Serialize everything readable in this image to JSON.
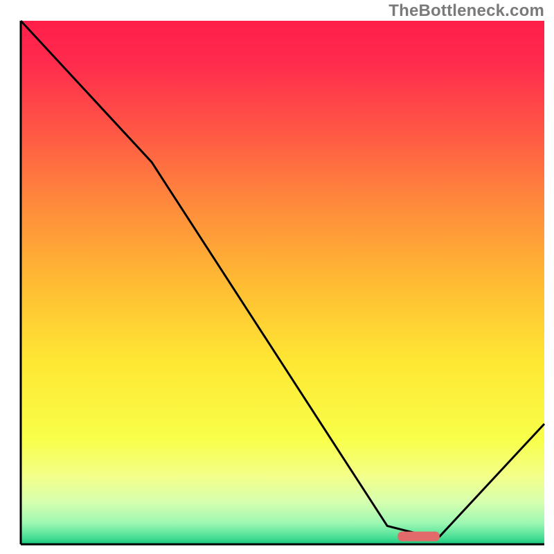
{
  "watermark": "TheBottleneck.com",
  "chart_data": {
    "type": "line",
    "title": "",
    "xlabel": "",
    "ylabel": "",
    "xlim": [
      0,
      100
    ],
    "ylim": [
      0,
      100
    ],
    "series": [
      {
        "name": "bottleneck-curve",
        "x": [
          0,
          25,
          70,
          78,
          80,
          100
        ],
        "values": [
          100,
          73,
          3.5,
          1.5,
          1.5,
          23
        ]
      }
    ],
    "marker": {
      "x_start": 72,
      "x_end": 80,
      "y": 1.5,
      "color": "#e36a6a"
    },
    "gradient_stops": [
      {
        "offset": 0.0,
        "color": "#ff1f4a"
      },
      {
        "offset": 0.08,
        "color": "#ff2b4d"
      },
      {
        "offset": 0.2,
        "color": "#ff5346"
      },
      {
        "offset": 0.35,
        "color": "#ff8a3c"
      },
      {
        "offset": 0.5,
        "color": "#ffbb33"
      },
      {
        "offset": 0.65,
        "color": "#ffe733"
      },
      {
        "offset": 0.8,
        "color": "#f8ff4a"
      },
      {
        "offset": 0.87,
        "color": "#f3ff8a"
      },
      {
        "offset": 0.92,
        "color": "#d6ffb0"
      },
      {
        "offset": 0.96,
        "color": "#9cf7b2"
      },
      {
        "offset": 0.985,
        "color": "#4fe198"
      },
      {
        "offset": 1.0,
        "color": "#17c97c"
      }
    ],
    "axis": {
      "color": "#000000",
      "width": 3
    }
  }
}
